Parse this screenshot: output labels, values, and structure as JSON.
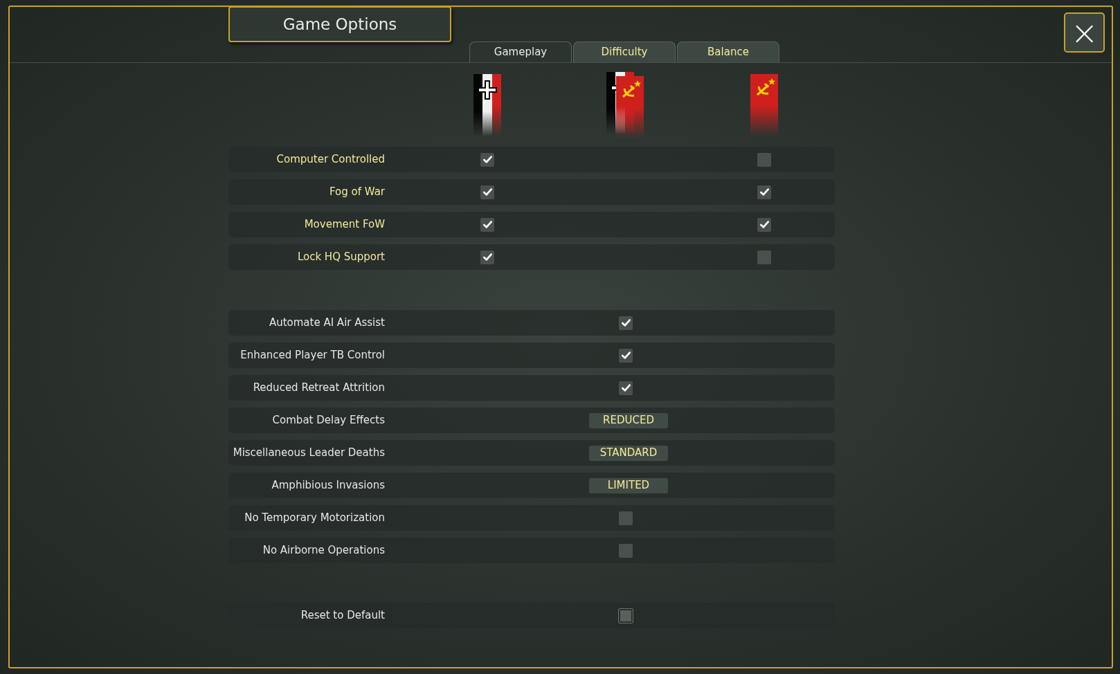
{
  "title": "Game Options",
  "tabs": [
    {
      "label": "Gameplay",
      "selected": true
    },
    {
      "label": "Difficulty",
      "selected": false
    },
    {
      "label": "Balance",
      "selected": false
    }
  ],
  "close_button": {
    "label": "×"
  },
  "side_options": [
    {
      "label": "Computer Controlled",
      "axis_checked": true,
      "soviet_checked": false
    },
    {
      "label": "Fog of War",
      "axis_checked": true,
      "soviet_checked": true
    },
    {
      "label": "Movement FoW",
      "axis_checked": true,
      "soviet_checked": true
    },
    {
      "label": "Lock HQ Support",
      "axis_checked": true,
      "soviet_checked": false
    }
  ],
  "general_options": [
    {
      "label": "Automate AI Air Assist",
      "kind": "checkbox",
      "checked": true
    },
    {
      "label": "Enhanced Player TB Control",
      "kind": "checkbox",
      "checked": true
    },
    {
      "label": "Reduced Retreat Attrition",
      "kind": "checkbox",
      "checked": true
    },
    {
      "label": "Combat Delay Effects",
      "kind": "choice",
      "value": "REDUCED"
    },
    {
      "label": "Miscellaneous Leader Deaths",
      "kind": "choice",
      "value": "STANDARD"
    },
    {
      "label": "Amphibious Invasions",
      "kind": "choice",
      "value": "LIMITED"
    },
    {
      "label": "No Temporary Motorization",
      "kind": "checkbox",
      "checked": false
    },
    {
      "label": "No Airborne Operations",
      "kind": "checkbox",
      "checked": false
    }
  ],
  "reset": {
    "label": "Reset to Default",
    "checked": false
  }
}
